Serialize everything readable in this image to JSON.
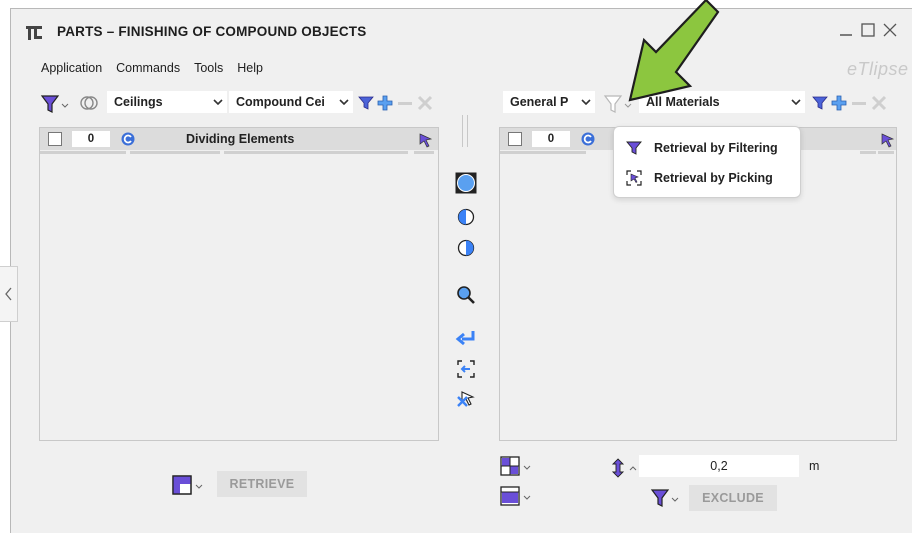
{
  "window": {
    "title": "PARTS – FINISHING OF COMPOUND OBJECTS",
    "brand": "eTlipse",
    "controls": [
      "minimize-icon",
      "maximize-icon",
      "close-icon"
    ]
  },
  "menu": [
    "Application",
    "Commands",
    "Tools",
    "Help"
  ],
  "left": {
    "category": "Ceilings",
    "type": "Compound Cei",
    "count": "0",
    "header": "Dividing Elements",
    "retrieve_label": "RETRIEVE"
  },
  "right": {
    "scope": "General P",
    "materials": "All Materials",
    "count": "0",
    "value": "0,2",
    "unit": "m",
    "exclude_label": "EXCLUDE"
  },
  "popup": {
    "items": [
      "Retrieval by Filtering",
      "Retrieval by Picking"
    ]
  },
  "colors": {
    "accent_purple": "#6a4fd8",
    "accent_blue": "#3b82f6",
    "arrow_green": "#8cc63f",
    "panel_bg": "#f0f0f0"
  }
}
